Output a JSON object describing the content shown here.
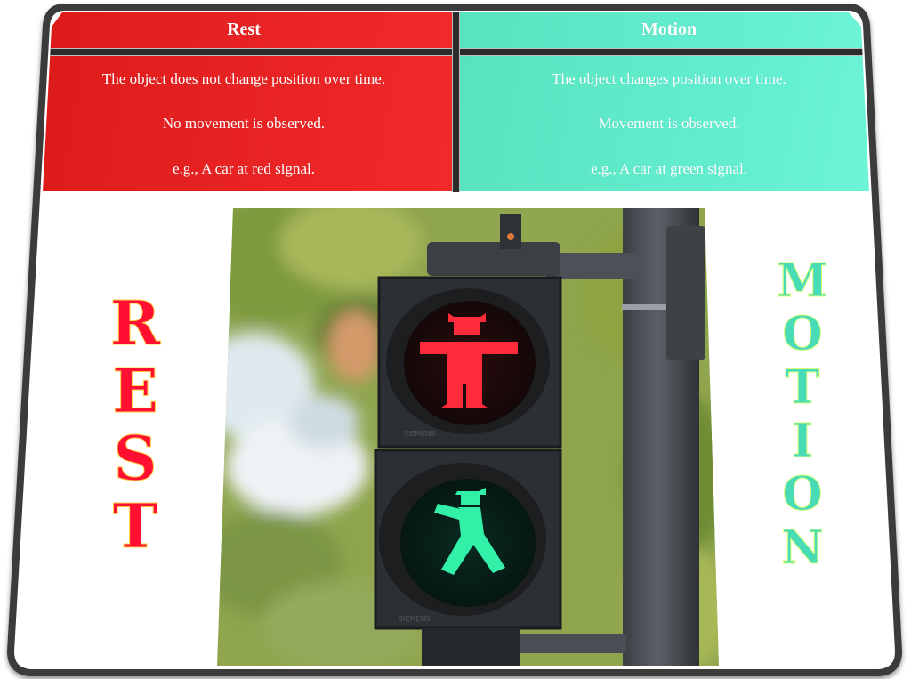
{
  "table": {
    "rest": {
      "header": "Rest",
      "lines": [
        "The object does not change position over time.",
        "No movement is observed.",
        "e.g., A car at red signal."
      ],
      "color": "#e41f1f"
    },
    "motion": {
      "header": "Motion",
      "lines": [
        "The object changes position over time.",
        "Movement is observed.",
        "e.g., A car at green signal."
      ],
      "color": "#5ee8c7"
    }
  },
  "side_labels": {
    "rest": [
      "R",
      "E",
      "S",
      "T"
    ],
    "motion": [
      "M",
      "O",
      "T",
      "I",
      "O",
      "N"
    ],
    "rest_color": "#ff1033",
    "motion_color": "#48dcb6"
  },
  "photo": {
    "subject": "pedestrian traffic light with red standing man and green walking man",
    "red_light_color": "#ff2a3a",
    "green_light_color": "#32f0a8",
    "brand_text": "SIEMENS"
  }
}
